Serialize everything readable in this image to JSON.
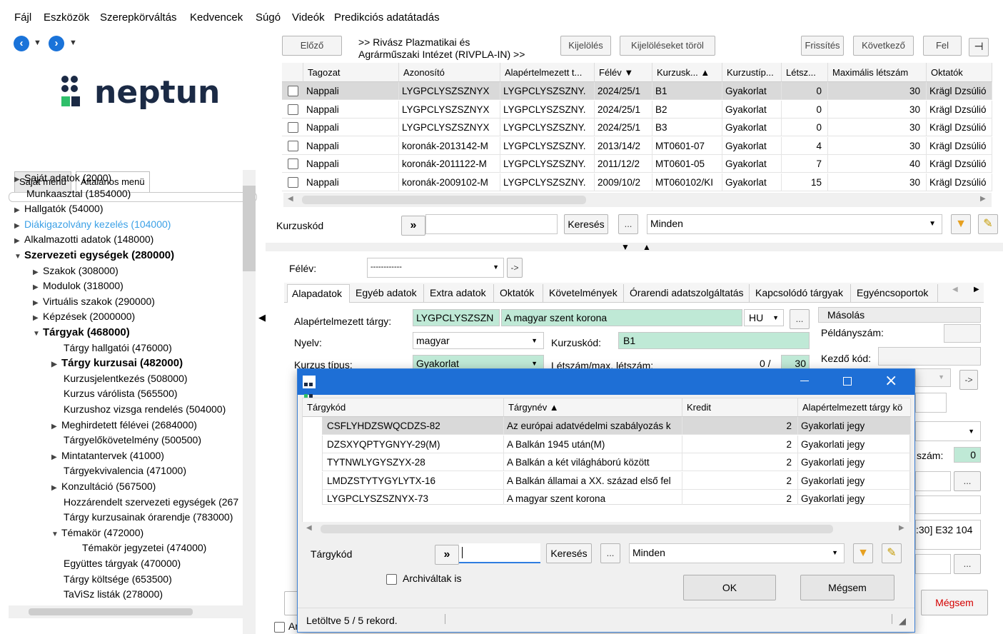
{
  "menu": [
    "Fájl",
    "Eszközök",
    "Szerepkörváltás",
    "Kedvencek",
    "Súgó",
    "Videók",
    "Predikciós adatátadás"
  ],
  "logo": "neptun",
  "left_tabs": [
    "Saját menü",
    "Általános menü"
  ],
  "tree": [
    {
      "t": "Saját adatok (2000)",
      "a": "▶",
      "d": 0
    },
    {
      "t": "Munkaasztal (1854000)",
      "a": "",
      "d": 0
    },
    {
      "t": "Hallgatók (54000)",
      "a": "▶",
      "d": 0
    },
    {
      "t": "Diákigazolvány kezelés (104000)",
      "a": "▶",
      "d": 0,
      "link": true
    },
    {
      "t": "Alkalmazotti adatok (148000)",
      "a": "▶",
      "d": 0
    },
    {
      "t": "Szervezeti egységek (280000)",
      "a": "▼",
      "d": 0,
      "b": true
    },
    {
      "t": "Szakok (308000)",
      "a": "▶",
      "d": 1
    },
    {
      "t": "Modulok (318000)",
      "a": "▶",
      "d": 1
    },
    {
      "t": "Virtuális szakok (290000)",
      "a": "▶",
      "d": 1
    },
    {
      "t": "Képzések (2000000)",
      "a": "▶",
      "d": 1
    },
    {
      "t": "Tárgyak (468000)",
      "a": "▼",
      "d": 1,
      "b": true
    },
    {
      "t": "Tárgy hallgatói (476000)",
      "a": "",
      "d": 2
    },
    {
      "t": "Tárgy kurzusai (482000)",
      "a": "▶",
      "d": 2,
      "b": true
    },
    {
      "t": "Kurzusjelentkezés (508000)",
      "a": "",
      "d": 2
    },
    {
      "t": "Kurzus várólista (565500)",
      "a": "",
      "d": 2
    },
    {
      "t": "Kurzushoz vizsga rendelés (504000)",
      "a": "",
      "d": 2
    },
    {
      "t": "Meghirdetett félévei (2684000)",
      "a": "▶",
      "d": 2
    },
    {
      "t": "Tárgyelőkövetelmény (500500)",
      "a": "",
      "d": 2
    },
    {
      "t": "Mintatantervek (41000)",
      "a": "▶",
      "d": 2
    },
    {
      "t": "Tárgyekvivalencia (471000)",
      "a": "",
      "d": 2
    },
    {
      "t": "Konzultáció (567500)",
      "a": "▶",
      "d": 2
    },
    {
      "t": "Hozzárendelt szervezeti egységek (267",
      "a": "",
      "d": 2
    },
    {
      "t": "Tárgy kurzusainak órarendje (783000)",
      "a": "",
      "d": 2
    },
    {
      "t": "Témakör (472000)",
      "a": "▼",
      "d": 2
    },
    {
      "t": "Témakör jegyzetei (474000)",
      "a": "",
      "d": 3
    },
    {
      "t": "Együttes tárgyak (470000)",
      "a": "",
      "d": 2
    },
    {
      "t": "Tárgy költsége (653500)",
      "a": "",
      "d": 2
    },
    {
      "t": "TaViSz listák (278000)",
      "a": "",
      "d": 2
    }
  ],
  "toolbar": {
    "prev": "Előző",
    "path1": ">> Rivász Plazmatikai és",
    "path2": "Agrárműszaki Intézet (RIVPLA-IN) >>",
    "select": "Kijelölés",
    "clear": "Kijelöléseket töröl",
    "refresh": "Frissítés",
    "next": "Következő",
    "up": "Fel"
  },
  "grid": {
    "headers": [
      "Tagozat",
      "Azonosító",
      "Alapértelmezett t...",
      "Félév  ▼",
      "Kurzusk...  ▲",
      "Kurzustíp...",
      "Létsz...",
      "Maximális létszám",
      "Oktatók"
    ],
    "rows": [
      [
        "Nappali",
        "LYGPCLYSZSZNYX",
        "LYGPCLYSZSZNY.",
        "2024/25/1",
        "B1",
        "Gyakorlat",
        "0",
        "30",
        "Krägl Dzsúlió"
      ],
      [
        "Nappali",
        "LYGPCLYSZSZNYX",
        "LYGPCLYSZSZNY.",
        "2024/25/1",
        "B2",
        "Gyakorlat",
        "0",
        "30",
        "Krägl Dzsúlió"
      ],
      [
        "Nappali",
        "LYGPCLYSZSZNYX",
        "LYGPCLYSZSZNY.",
        "2024/25/1",
        "B3",
        "Gyakorlat",
        "0",
        "30",
        "Krägl Dzsúlió"
      ],
      [
        "Nappali",
        "koronák-2013142-M",
        "LYGPCLYSZSZNY.",
        "2013/14/2",
        "MT0601-07",
        "Gyakorlat",
        "4",
        "30",
        "Krägl Dzsúlió"
      ],
      [
        "Nappali",
        "koronák-2011122-M",
        "LYGPCLYSZSZNY.",
        "2011/12/2",
        "MT0601-05",
        "Gyakorlat",
        "7",
        "40",
        "Krägl Dzsúlió"
      ],
      [
        "Nappali",
        "koronák-2009102-M",
        "LYGPCLYSZSZNY.",
        "2009/10/2",
        "MT060102/KI",
        "Gyakorlat",
        "15",
        "30",
        "Krägl Dzsúlió"
      ]
    ]
  },
  "search1": {
    "label": "Kurzuskód",
    "go": "»",
    "btn": "Keresés",
    "dots": "...",
    "filter": "Minden"
  },
  "felev": {
    "label": "Félév:",
    "value": "------------",
    "go": "->"
  },
  "tabs": [
    "Alapadatok",
    "Egyéb adatok",
    "Extra adatok",
    "Oktatók",
    "Követelmények",
    "Órarendi adatszolgáltatás",
    "Kapcsolódó tárgyak",
    "Egyéncsoportok"
  ],
  "form": {
    "subject_label": "Alapértelmezett tárgy:",
    "subject_code": "LYGPCLYSZSZN",
    "subject_name": "A magyar szent korona",
    "lang_code": "HU",
    "lang_label": "Nyelv:",
    "lang": "magyar",
    "code_label": "Kurzuskód:",
    "code": "B1",
    "type_label": "Kurzus típus:",
    "type": "Gyakorlat",
    "count_label": "Létszám/max. létszám:",
    "count": "0 /",
    "max": "30",
    "copy": "Másolás",
    "copies": "Példányszám:",
    "start": "Kezdő kód:",
    "szam": "szám:",
    "szam_val": "0",
    "room": ":30] E32 104",
    "cancel": "Mégsem",
    "archiv": "Ar"
  },
  "dialog": {
    "headers": [
      "Tárgykód",
      "Tárgynév  ▲",
      "Kredit",
      "Alapértelmezett tárgy kö"
    ],
    "rows": [
      [
        "CSFLYHDZSWQCDZS-82",
        "Az európai adatvédelmi szabályozás k",
        "2",
        "Gyakorlati jegy"
      ],
      [
        "DZSXYQPTYGNYY-29(M)",
        "A Balkán 1945 után(M)",
        "2",
        "Gyakorlati jegy"
      ],
      [
        "TYTNWLYGYSZYX-28",
        "A Balkán a két világháború között",
        "2",
        "Gyakorlati jegy"
      ],
      [
        "LMDZSTYTYGYLYTX-16",
        "A Balkán államai a XX. század első fel",
        "2",
        "Gyakorlati jegy"
      ],
      [
        "LYGPCLYSZSZNYX-73",
        "A magyar szent korona",
        "2",
        "Gyakorlati jegy"
      ]
    ],
    "search_label": "Tárgykód",
    "go": "»",
    "search_btn": "Keresés",
    "dots": "...",
    "filter": "Minden",
    "archive": "Archiváltak is",
    "ok": "OK",
    "cancel": "Mégsem",
    "status": "Letöltve 5 / 5 rekord."
  }
}
